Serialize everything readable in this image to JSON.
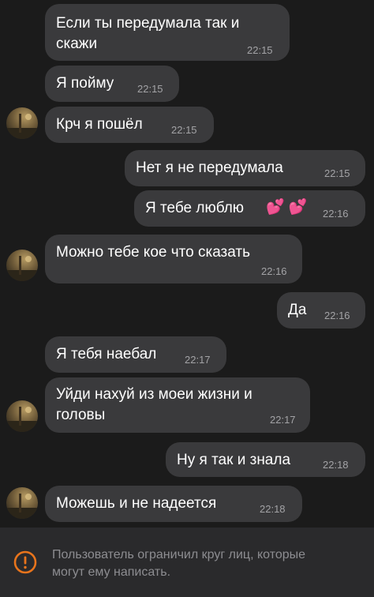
{
  "messages": [
    {
      "text_line1": "Если ты передумала так и",
      "text_line2": "скажи",
      "time": "22:15"
    },
    {
      "text": "Я пойму",
      "time": "22:15"
    },
    {
      "text": "Крч я пошёл",
      "time": "22:15"
    },
    {
      "text": "Нет я не передумала",
      "time": "22:15"
    },
    {
      "text": "Я тебе люблю",
      "emoji": "💕 💕",
      "time": "22:16"
    },
    {
      "text": "Можно тебе кое что сказать",
      "time": "22:16"
    },
    {
      "text": "Да",
      "time": "22:16"
    },
    {
      "text": "Я тебя наебал",
      "time": "22:17"
    },
    {
      "text_line1": "Уйди нахуй из моеи жизни и",
      "text_line2": "головы",
      "time": "22:17"
    },
    {
      "text": "Ну я так и знала",
      "time": "22:18"
    },
    {
      "text": "Можешь и не надеется",
      "time": "22:18"
    }
  ],
  "footer": {
    "icon": "warning-icon",
    "text_line1": "Пользователь ограничил круг лиц, которые",
    "text_line2": "могут ему написать."
  },
  "colors": {
    "background": "#1b1b1b",
    "bubble": "#3a3a3c",
    "footer_bg": "#2a2a2c",
    "warning": "#e8741c"
  }
}
